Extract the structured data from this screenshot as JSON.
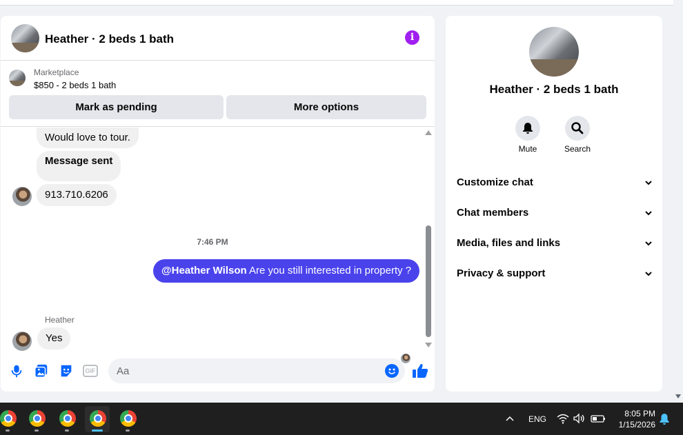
{
  "chat": {
    "title": "Heather · 2 beds 1 bath",
    "marketplace_label": "Marketplace",
    "listing": "$850 - 2 beds 1 bath",
    "mark_pending_label": "Mark as pending",
    "more_options_label": "More options"
  },
  "messages": {
    "m1": "Would love to tour.",
    "m2": "Message sent",
    "m3": "913.710.6206",
    "timestamp": "7:46 PM",
    "out_mention": "@Heather Wilson",
    "out_text": " Are you still interested in property ?",
    "sender": "Heather",
    "m5": "Yes"
  },
  "composer": {
    "placeholder": "Aa",
    "gif_label": "GIF"
  },
  "info_panel": {
    "name": "Heather · 2 beds 1 bath",
    "mute_label": "Mute",
    "search_label": "Search",
    "rows": [
      "Customize chat",
      "Chat members",
      "Media, files and links",
      "Privacy & support"
    ]
  },
  "taskbar": {
    "language": "ENG",
    "time": "8:05 PM",
    "date": "1/15/2026"
  },
  "colors": {
    "accent": "#0866ff",
    "outgoing_bubble": "#4a43ec",
    "info_icon": "#a020f0"
  }
}
